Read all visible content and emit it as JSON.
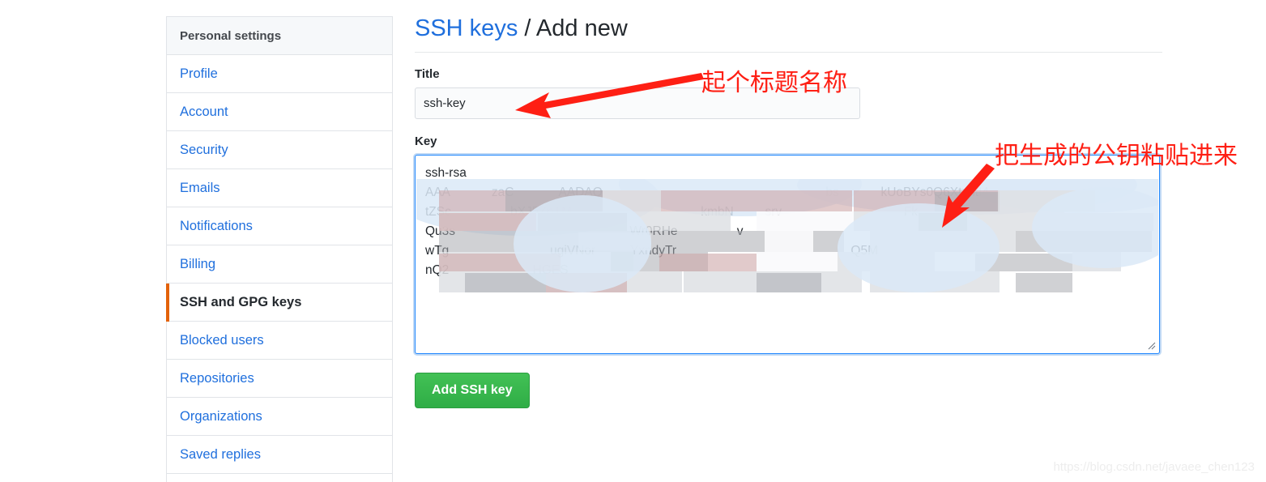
{
  "sidebar": {
    "header": "Personal settings",
    "items": [
      {
        "label": "Profile",
        "active": false
      },
      {
        "label": "Account",
        "active": false
      },
      {
        "label": "Security",
        "active": false
      },
      {
        "label": "Emails",
        "active": false
      },
      {
        "label": "Notifications",
        "active": false
      },
      {
        "label": "Billing",
        "active": false
      },
      {
        "label": "SSH and GPG keys",
        "active": true
      },
      {
        "label": "Blocked users",
        "active": false
      },
      {
        "label": "Repositories",
        "active": false
      },
      {
        "label": "Organizations",
        "active": false
      },
      {
        "label": "Saved replies",
        "active": false
      }
    ],
    "active_indicator_color": "#e36209",
    "link_color": "#1f6fdd"
  },
  "header": {
    "breadcrumb_link": "SSH keys",
    "breadcrumb_separator": "/",
    "breadcrumb_current": "Add new"
  },
  "form": {
    "title_label": "Title",
    "title_value": "ssh-key",
    "title_placeholder": "",
    "key_label": "Key",
    "key_value": "ssh-rsa\nAAA            zaC             AADAQ                                                                bs            kUoBYs0Q6XtzhtI4\ntZSc                 bXJ5ZnTM                                     kmbN         srv                                   Fk\nQu3s                                                  Wr0RHe                 v\nwTg                             ugiVNor          YxndyTr                                                  Q5M\nnQ2                        HGES",
    "key_placeholder": "",
    "submit_label": "Add SSH key",
    "submit_color": "#2fad46"
  },
  "annotations": [
    {
      "text": "起个标题名称",
      "color": "#fe1f14"
    },
    {
      "text": "把生成的公钥粘贴进来",
      "color": "#fe1f14"
    }
  ],
  "watermark": "https://blog.csdn.net/javaee_chen123"
}
